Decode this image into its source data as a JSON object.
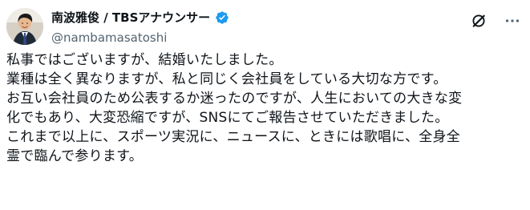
{
  "header": {
    "display_name": "南波雅俊 / TBSアナウンサー",
    "handle": "@nambamasatoshi",
    "verified_icon": "verified-badge-icon",
    "grok_icon": "grok-icon",
    "more_icon": "more-options-icon"
  },
  "post": {
    "lines": [
      "私事ではございますが、結婚いたしました。",
      "業種は全く異なりますが、私と同じく会社員をしている大切な方です。",
      "お互い会社員のため公表するか迷ったのですが、人生においての大きな変",
      "化でもあり、大変恐縮ですが、SNSにてご報告させていただきました。",
      "これまで以上に、スポーツ実況に、ニュースに、ときには歌唱に、全身全",
      "霊で臨んで参ります。"
    ]
  },
  "colors": {
    "text": "#0f1419",
    "secondary": "#536471",
    "verified": "#1d9bf0",
    "background": "#ffffff"
  }
}
